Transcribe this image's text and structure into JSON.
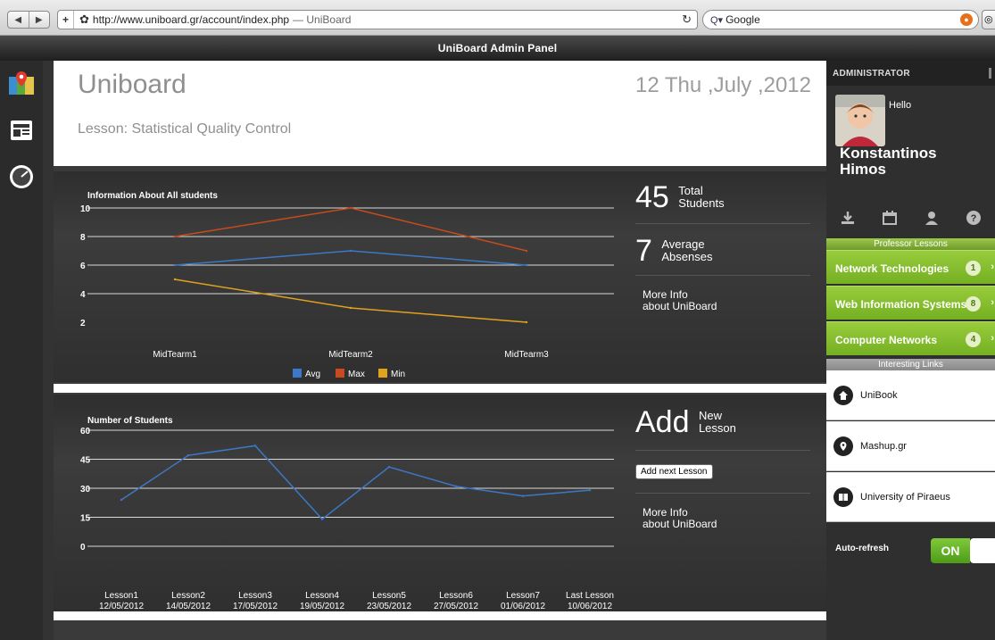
{
  "browser": {
    "url": "http://www.uniboard.gr/account/index.php",
    "tab_title": "— UniBoard",
    "search_placeholder": "Google"
  },
  "app": {
    "titlebar": "UniBoard Admin Panel",
    "title": "Uniboard",
    "date": "12 Thu ,July ,2012",
    "lesson": "Lesson: Statistical Quality Control"
  },
  "rail": {
    "icons": [
      "map-icon",
      "dashboard-icon",
      "gauge-icon"
    ]
  },
  "stats": {
    "total_students_value": "45",
    "total_students_label_1": "Total",
    "total_students_label_2": "Students",
    "absenses_value": "7",
    "absenses_label_1": "Average",
    "absenses_label_2": "Absenses",
    "more_info_1": "More Info",
    "more_info_2": "about UniBoard",
    "add_value": "Add",
    "add_label_1": "New",
    "add_label_2": "Lesson",
    "add_next_button": "Add next Lesson"
  },
  "chart_data": [
    {
      "type": "line",
      "title": "Information About All students",
      "categories": [
        "MidTearm1",
        "MidTearm2",
        "MidTearm3"
      ],
      "ylim": [
        2,
        10
      ],
      "yticks": [
        "10",
        "8",
        "6",
        "4",
        "2"
      ],
      "series": [
        {
          "name": "Avg",
          "values": [
            6,
            7,
            6
          ],
          "color": "#3c78c8"
        },
        {
          "name": "Max",
          "values": [
            8,
            10,
            7
          ],
          "color": "#c84a1e"
        },
        {
          "name": "Min",
          "values": [
            5,
            3,
            2
          ],
          "color": "#e0a21c"
        }
      ],
      "legend": "bottom",
      "grid": true
    },
    {
      "type": "line",
      "title": "Number of Students",
      "categories": [
        "Lesson1",
        "Lesson2",
        "Lesson3",
        "Lesson4",
        "Lesson5",
        "Lesson6",
        "Lesson7",
        "Last Lesson"
      ],
      "dates": [
        "12/05/2012",
        "14/05/2012",
        "17/05/2012",
        "19/05/2012",
        "23/05/2012",
        "27/05/2012",
        "01/06/2012",
        "10/06/2012"
      ],
      "ylim": [
        0,
        60
      ],
      "yticks": [
        "60",
        "45",
        "30",
        "15",
        "0"
      ],
      "series": [
        {
          "name": "Number of Students",
          "values": [
            24,
            47,
            52,
            14,
            41,
            31,
            26,
            29
          ],
          "color": "#3c78c8"
        }
      ],
      "legend": "bottom",
      "grid": true
    }
  ],
  "sidebar": {
    "admin_header": "ADMINISTRATOR",
    "hello": "Hello",
    "name_line1": "Konstantinos",
    "name_line2": "Himos",
    "professor_lessons_title": "Professor Lessons",
    "lessons": [
      {
        "label": "Network Technologies",
        "count": "1"
      },
      {
        "label": "Web Information Systems",
        "count": "8"
      },
      {
        "label": "Computer Networks",
        "count": "4"
      }
    ],
    "links_title": "Interesting Links",
    "links": [
      {
        "label": "UniBook",
        "icon": "home-icon"
      },
      {
        "label": "Mashup.gr",
        "icon": "pin-icon"
      },
      {
        "label": "University of Piraeus",
        "icon": "book-icon"
      }
    ],
    "autorefresh_label": "Auto-refresh",
    "autorefresh_state": "ON"
  }
}
